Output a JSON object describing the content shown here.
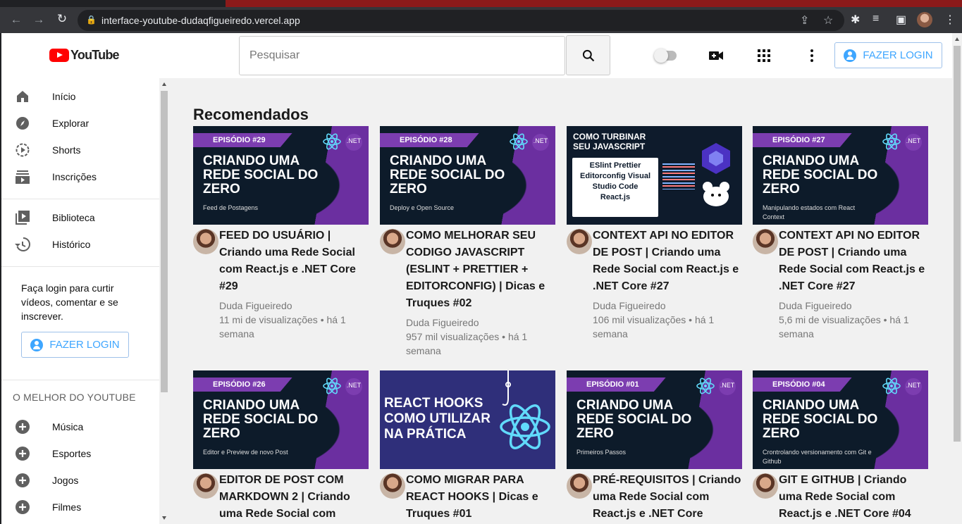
{
  "browser": {
    "url": "interface-youtube-dudaqfigueiredo.vercel.app"
  },
  "header": {
    "logo_text": "YouTube",
    "search_placeholder": "Pesquisar",
    "login_label": "FAZER LOGIN"
  },
  "sidebar": {
    "items": [
      {
        "label": "Início",
        "icon": "home-icon"
      },
      {
        "label": "Explorar",
        "icon": "compass-icon"
      },
      {
        "label": "Shorts",
        "icon": "shorts-icon"
      },
      {
        "label": "Inscrições",
        "icon": "subscriptions-icon"
      },
      {
        "label": "Biblioteca",
        "icon": "library-icon"
      },
      {
        "label": "Histórico",
        "icon": "history-icon"
      }
    ],
    "login_prompt": "Faça login para curtir vídeos, comentar e se inscrever.",
    "login_label": "FAZER LOGIN",
    "section_title": "O MELHOR DO YOUTUBE",
    "best": [
      {
        "label": "Música"
      },
      {
        "label": "Esportes"
      },
      {
        "label": "Jogos"
      },
      {
        "label": "Filmes"
      }
    ]
  },
  "main": {
    "title": "Recomendados",
    "videos": [
      {
        "episode": "EPISÓDIO #29",
        "headline": "CRIANDO UMA REDE SOCIAL DO ZERO",
        "subtitle": "Feed de Postagens",
        "title": "FEED DO USUÁRIO | Criando uma Rede Social com React.js e .NET Core #29",
        "channel": "Duda Figueiredo",
        "meta": "11 mi de visualizações • há 1 semana"
      },
      {
        "episode": "EPISÓDIO #28",
        "headline": "CRIANDO UMA REDE SOCIAL DO ZERO",
        "subtitle": "Deploy e Open Source",
        "title": "COMO MELHORAR SEU CODIGO JAVASCRIPT (ESLINT + PRETTIER + EDITORCONFIG) | Dicas e Truques #02",
        "channel": "Duda Figueiredo",
        "meta": "957 mil visualizações • há 1 semana"
      },
      {
        "episode": "",
        "headline": "COMO TURBINAR SEU JAVASCRIPT",
        "subtitle": "ESlint Prettier Editorconfig Visual Studio Code React.js",
        "title": "CONTEXT API NO EDITOR DE POST | Criando uma Rede Social com React.js e .NET Core #27",
        "channel": "Duda Figueiredo",
        "meta": "106 mil visualizações • há 1 semana"
      },
      {
        "episode": "EPISÓDIO #27",
        "headline": "CRIANDO UMA REDE SOCIAL DO ZERO",
        "subtitle": "Manipulando estados com React Context",
        "title": "CONTEXT API NO EDITOR DE POST | Criando uma Rede Social com React.js e .NET Core #27",
        "channel": "Duda Figueiredo",
        "meta": "5,6 mi de visualizações • há 1 semana"
      },
      {
        "episode": "EPISÓDIO #26",
        "headline": "CRIANDO UMA REDE SOCIAL DO ZERO",
        "subtitle": "Editor e Preview de novo Post",
        "title": "EDITOR DE POST COM MARKDOWN 2 | Criando uma Rede Social com",
        "channel": "",
        "meta": ""
      },
      {
        "episode": "",
        "headline": "REACT HOOKS COMO UTILIZAR NA PRÁTICA",
        "subtitle": "",
        "title": "COMO MIGRAR PARA REACT HOOKS | Dicas e Truques #01",
        "channel": "",
        "meta": ""
      },
      {
        "episode": "EPISÓDIO #01",
        "headline": "CRIANDO UMA REDE SOCIAL DO ZERO",
        "subtitle": "Primeiros Passos",
        "title": "PRÉ-REQUISITOS | Criando uma Rede Social com React.js e .NET Core",
        "channel": "",
        "meta": ""
      },
      {
        "episode": "EPISÓDIO #04",
        "headline": "CRIANDO UMA REDE SOCIAL DO ZERO",
        "subtitle": "Crontrolando versionamento com Git e Github",
        "title": "GIT E GITHUB | Criando uma Rede Social com React.js e .NET Core #04",
        "channel": "",
        "meta": ""
      }
    ]
  },
  "colors": {
    "accent": "#3ea6ff",
    "purple": "#6b2fa0",
    "navy": "#0d1b2a",
    "brand": "#ff0000"
  }
}
